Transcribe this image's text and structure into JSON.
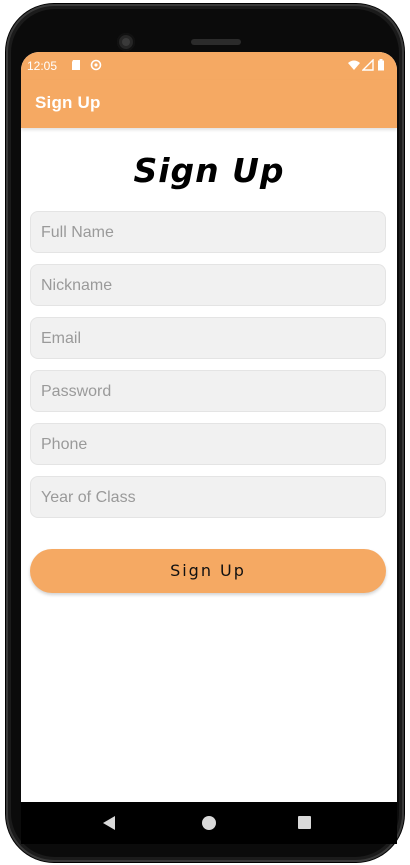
{
  "status_bar": {
    "time": "12:05"
  },
  "app_bar": {
    "title": "Sign Up"
  },
  "form": {
    "heading": "Sign Up",
    "fields": [
      {
        "placeholder": "Full Name",
        "value": ""
      },
      {
        "placeholder": "Nickname",
        "value": ""
      },
      {
        "placeholder": "Email",
        "value": ""
      },
      {
        "placeholder": "Password",
        "value": ""
      },
      {
        "placeholder": "Phone",
        "value": ""
      },
      {
        "placeholder": "Year of Class",
        "value": ""
      }
    ],
    "submit_label": "Sign Up"
  },
  "colors": {
    "accent": "#f5a963",
    "field_bg": "#f1f1f1",
    "placeholder": "#9a9a9a"
  },
  "icons": {
    "status_left": [
      "sd-card-icon",
      "sync-icon"
    ],
    "status_right": [
      "wifi-icon",
      "cell-signal-icon",
      "battery-icon"
    ],
    "nav": [
      "back-icon",
      "home-icon",
      "recent-apps-icon"
    ]
  }
}
